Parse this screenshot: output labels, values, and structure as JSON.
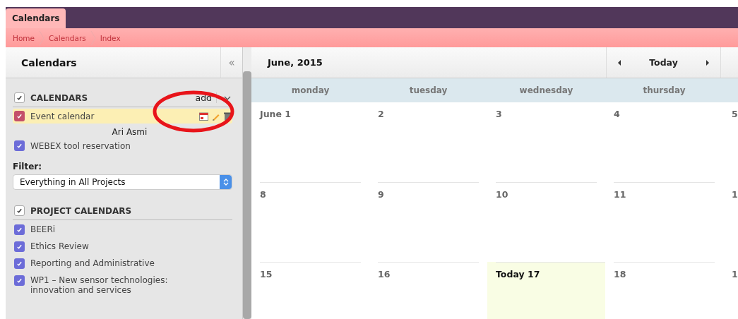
{
  "tabs": [
    {
      "label": "Calendars",
      "selected": true
    }
  ],
  "breadcrumb": [
    "Home",
    "Calendars",
    "Index"
  ],
  "sidebar": {
    "title": "Calendars",
    "collapse_icon": "«",
    "calendars_section": {
      "title": "CALENDARS",
      "checked": true,
      "add": "add",
      "items": [
        {
          "name": "Event calendar",
          "checked": true,
          "color": "#c4506a",
          "selected": true,
          "owner": "Ari Asmi"
        },
        {
          "name": "WEBEX tool reservation",
          "checked": true,
          "color": "#6c6cd8",
          "selected": false
        }
      ]
    },
    "filter": {
      "label": "Filter:",
      "value": "Everything in All Projects"
    },
    "project_section": {
      "title": "PROJECT CALENDARS",
      "checked": true,
      "items": [
        {
          "name": "BEERi",
          "checked": true,
          "color": "#6c6cd8"
        },
        {
          "name": "Ethics Review",
          "checked": true,
          "color": "#6c6cd8"
        },
        {
          "name": "Reporting and Administrative",
          "checked": true,
          "color": "#6c6cd8"
        },
        {
          "name": "WP1 – New sensor technologies: innovation and services",
          "checked": true,
          "color": "#6c6cd8"
        }
      ]
    }
  },
  "calendar": {
    "title": "June, 2015",
    "today_button": "Today",
    "weekdays": [
      "monday",
      "tuesday",
      "wednesday",
      "thursday"
    ],
    "weeks": [
      [
        {
          "label": "June 1",
          "today": false
        },
        {
          "label": "2",
          "today": false
        },
        {
          "label": "3",
          "today": false
        },
        {
          "label": "4",
          "today": false
        },
        {
          "label": "5",
          "today": false
        }
      ],
      [
        {
          "label": "8",
          "today": false
        },
        {
          "label": "9",
          "today": false
        },
        {
          "label": "10",
          "today": false
        },
        {
          "label": "11",
          "today": false
        },
        {
          "label": "1",
          "today": false
        }
      ],
      [
        {
          "label": "15",
          "today": false
        },
        {
          "label": "16",
          "today": false
        },
        {
          "label": "Today 17",
          "today": true
        },
        {
          "label": "18",
          "today": false
        },
        {
          "label": "1",
          "today": false
        }
      ]
    ]
  }
}
